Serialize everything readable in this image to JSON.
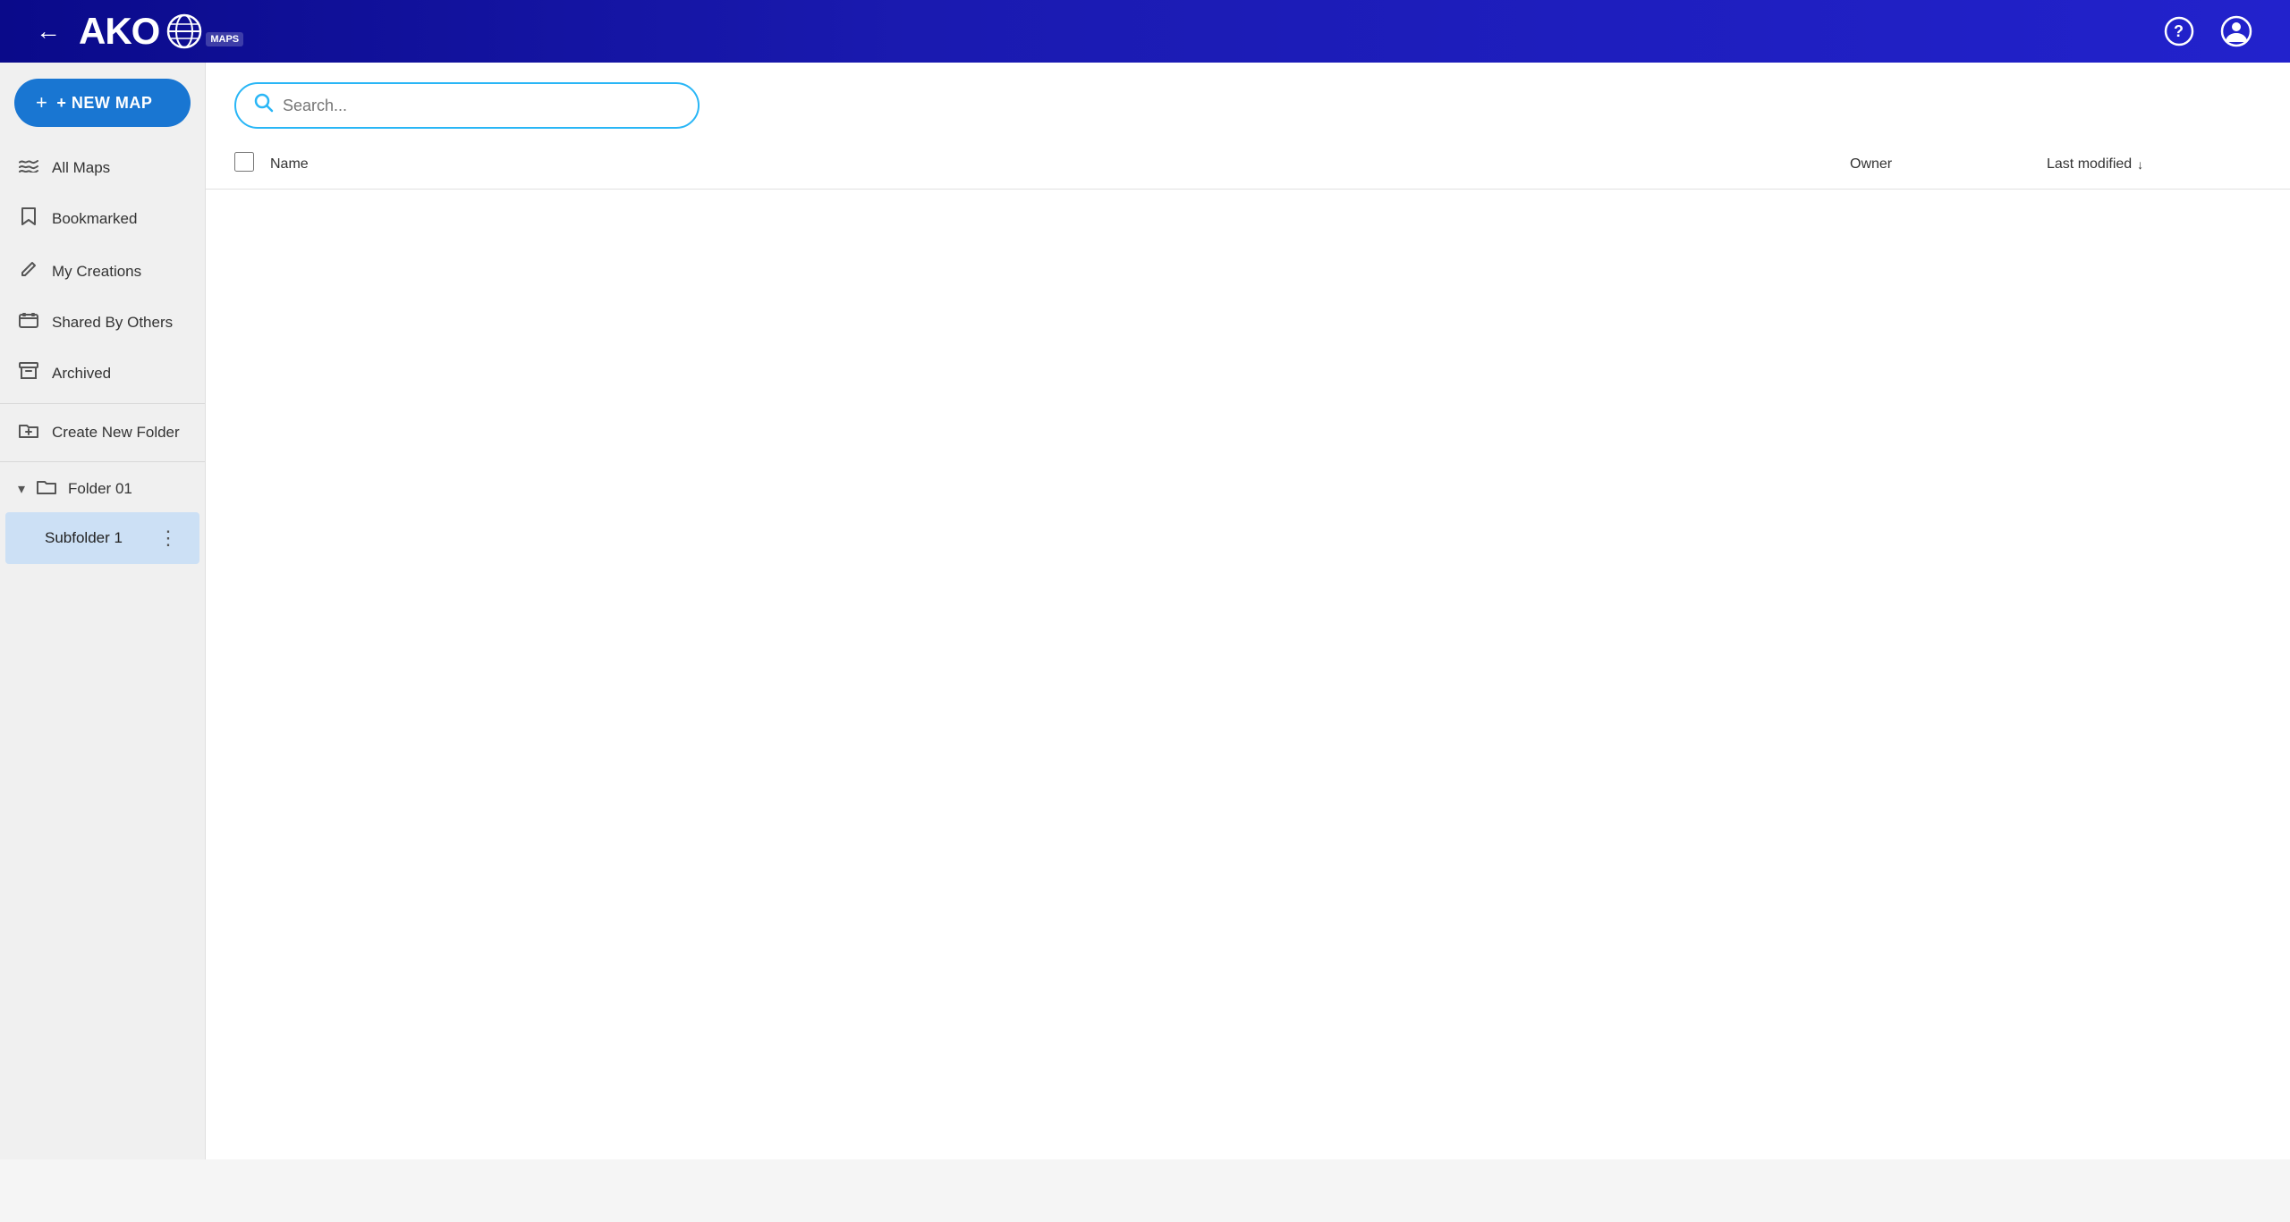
{
  "header": {
    "back_label": "←",
    "logo_text": "AKO",
    "logo_maps_label": "MAPS",
    "help_icon": "?",
    "account_icon": "👤"
  },
  "sidebar": {
    "new_map_button": "+ NEW MAP",
    "items": [
      {
        "id": "all-maps",
        "label": "All Maps",
        "icon": "∞"
      },
      {
        "id": "bookmarked",
        "label": "Bookmarked",
        "icon": "🔖"
      },
      {
        "id": "my-creations",
        "label": "My Creations",
        "icon": "✏️"
      },
      {
        "id": "shared-by-others",
        "label": "Shared By Others",
        "icon": "🖼"
      },
      {
        "id": "archived",
        "label": "Archived",
        "icon": "📥"
      },
      {
        "id": "create-new-folder",
        "label": "Create New Folder",
        "icon": "📁"
      }
    ],
    "folder": {
      "name": "Folder 01",
      "chevron": "v",
      "subfolder": "Subfolder 1"
    }
  },
  "search": {
    "placeholder": "Search..."
  },
  "table": {
    "columns": {
      "name": "Name",
      "owner": "Owner",
      "last_modified": "Last modified"
    }
  }
}
